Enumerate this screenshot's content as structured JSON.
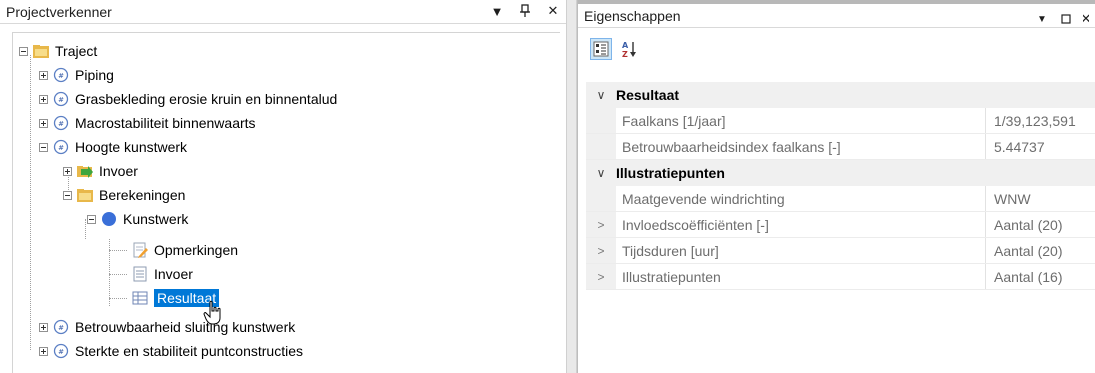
{
  "explorer": {
    "title": "Projectverkenner",
    "nodes": [
      {
        "label": "Traject"
      },
      {
        "label": "Piping"
      },
      {
        "label": "Grasbekleding erosie kruin en binnentalud"
      },
      {
        "label": "Macrostabiliteit binnenwaarts"
      },
      {
        "label": "Hoogte kunstwerk"
      },
      {
        "label": "Invoer"
      },
      {
        "label": "Berekeningen"
      },
      {
        "label": "Kunstwerk"
      },
      {
        "label": "Opmerkingen"
      },
      {
        "label": "Invoer"
      },
      {
        "label": "Resultaat"
      },
      {
        "label": "Betrouwbaarheid sluiting kunstwerk"
      },
      {
        "label": "Sterkte en stabiliteit puntconstructies"
      }
    ]
  },
  "properties": {
    "title": "Eigenschappen",
    "categories": [
      {
        "label": "Resultaat",
        "rows": [
          {
            "name": "Faalkans [1/jaar]",
            "value": "1/39,123,591"
          },
          {
            "name": "Betrouwbaarheidsindex faalkans [-]",
            "value": "5.44737"
          }
        ]
      },
      {
        "label": "Illustratiepunten",
        "rows": [
          {
            "name": "Maatgevende windrichting",
            "value": "WNW"
          },
          {
            "name": "Invloedscoëfficiënten [-]",
            "value": "Aantal (20)"
          },
          {
            "name": "Tijdsduren [uur]",
            "value": "Aantal (20)"
          },
          {
            "name": "Illustratiepunten",
            "value": "Aantal (16)"
          }
        ]
      }
    ]
  },
  "colors": {
    "selection": "#0078d7",
    "folder": "#f0c55a",
    "calc": "#3a6fd8"
  }
}
